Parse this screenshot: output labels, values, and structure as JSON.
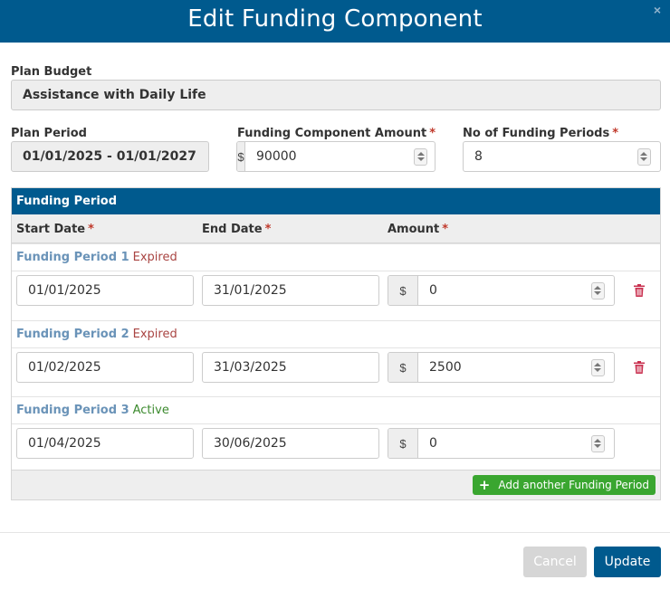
{
  "modal": {
    "title": "Edit Funding Component",
    "close_glyph": "×"
  },
  "form": {
    "plan_budget": {
      "label": "Plan Budget",
      "value": "Assistance with Daily Life"
    },
    "plan_period": {
      "label": "Plan Period",
      "value": "01/01/2025 - 01/01/2027"
    },
    "funding_amount": {
      "label": "Funding Component Amount",
      "required": "*",
      "currency": "$",
      "value": "90000"
    },
    "num_periods": {
      "label": "No of Funding Periods",
      "required": "*",
      "value": "8"
    }
  },
  "periods_panel": {
    "title": "Funding Period",
    "columns": {
      "start": "Start Date",
      "end": "End Date",
      "amount": "Amount",
      "required": "*"
    },
    "periods": [
      {
        "name": "Funding Period 1",
        "status": "Expired",
        "start": "01/01/2025",
        "end": "31/01/2025",
        "currency": "$",
        "amount": "0",
        "deletable": true
      },
      {
        "name": "Funding Period 2",
        "status": "Expired",
        "start": "01/02/2025",
        "end": "31/03/2025",
        "currency": "$",
        "amount": "2500",
        "deletable": true
      },
      {
        "name": "Funding Period 3",
        "status": "Active",
        "start": "01/04/2025",
        "end": "30/06/2025",
        "currency": "$",
        "amount": "0",
        "deletable": false
      }
    ],
    "add_button": {
      "icon": "plus-icon",
      "label": "Add another Funding Period"
    }
  },
  "footer": {
    "cancel_label": "Cancel",
    "update_label": "Update"
  },
  "colors": {
    "header_blue": "#005a8e",
    "expired": "#a94442",
    "active": "#3c8a2e",
    "add_green": "#3aa630",
    "trash_red": "#c9304f"
  }
}
